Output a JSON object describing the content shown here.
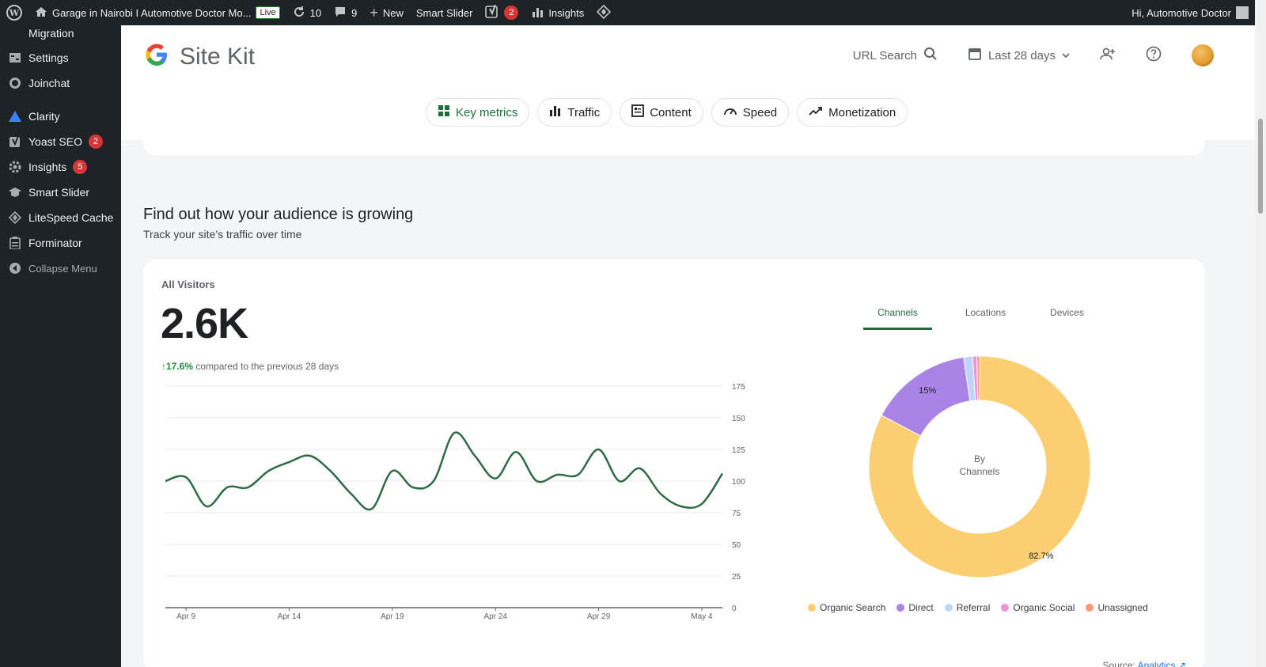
{
  "adminbar": {
    "site_title": "Garage in Nairobi I Automotive Doctor Mo...",
    "live_label": "Live",
    "updates_count": "10",
    "comments_count": "9",
    "new_label": "New",
    "smart_slider_label": "Smart Slider",
    "yoast_count": "2",
    "insights_label": "Insights",
    "greeting": "Hi, Automotive Doctor"
  },
  "sidebar": {
    "items": [
      {
        "label": "Migration"
      },
      {
        "label": "Settings"
      },
      {
        "label": "Joinchat"
      },
      {
        "label": "Clarity"
      },
      {
        "label": "Yoast SEO",
        "badge": "2"
      },
      {
        "label": "Insights",
        "badge": "5"
      },
      {
        "label": "Smart Slider"
      },
      {
        "label": "LiteSpeed Cache"
      },
      {
        "label": "Forminator"
      },
      {
        "label": "Collapse Menu"
      }
    ]
  },
  "header": {
    "brand": "Site Kit",
    "url_search": "URL Search",
    "date_range": "Last 28 days"
  },
  "nav_tabs": [
    {
      "label": "Key metrics"
    },
    {
      "label": "Traffic"
    },
    {
      "label": "Content"
    },
    {
      "label": "Speed"
    },
    {
      "label": "Monetization"
    }
  ],
  "section": {
    "title": "Find out how your audience is growing",
    "subtitle": "Track your site’s traffic over time"
  },
  "visitors": {
    "label": "All Visitors",
    "value": "2.6K",
    "change": "17.6%",
    "change_text": "compared to the previous 28 days"
  },
  "breakdown_tabs": [
    "Channels",
    "Locations",
    "Devices"
  ],
  "donut": {
    "center_line1": "By",
    "center_line2": "Channels"
  },
  "source": {
    "label": "Source:",
    "link": "Analytics"
  },
  "colors": {
    "line": "#2f6b45",
    "organic_search": "#fcce72",
    "direct": "#a983e6",
    "referral": "#bed4ff",
    "organic_social": "#ee92da",
    "unassigned": "#ff9b7a"
  },
  "chart_data": [
    {
      "type": "line",
      "x": [
        "Apr 8",
        "Apr 9",
        "Apr 10",
        "Apr 11",
        "Apr 12",
        "Apr 13",
        "Apr 14",
        "Apr 15",
        "Apr 16",
        "Apr 17",
        "Apr 18",
        "Apr 19",
        "Apr 20",
        "Apr 21",
        "Apr 22",
        "Apr 23",
        "Apr 24",
        "Apr 25",
        "Apr 26",
        "Apr 27",
        "Apr 28",
        "Apr 29",
        "Apr 30",
        "May 1",
        "May 2",
        "May 3",
        "May 4",
        "May 5"
      ],
      "x_tick_labels": [
        "Apr 9",
        "Apr 14",
        "Apr 19",
        "Apr 24",
        "Apr 29",
        "May 4"
      ],
      "series": [
        {
          "values": [
            100,
            103,
            80,
            95,
            95,
            108,
            115,
            120,
            108,
            90,
            78,
            108,
            95,
            100,
            138,
            120,
            102,
            123,
            100,
            105,
            105,
            125,
            100,
            110,
            90,
            80,
            82,
            106
          ]
        }
      ],
      "ylim": [
        0,
        175
      ],
      "yticks": [
        0,
        25,
        50,
        75,
        100,
        125,
        150,
        175
      ],
      "grid": true
    },
    {
      "type": "pie",
      "categories": [
        "Organic Search",
        "Direct",
        "Referral",
        "Organic Social",
        "Unassigned"
      ],
      "values": [
        82.7,
        15,
        1.3,
        0.6,
        0.4
      ],
      "labels": [
        "82.7%",
        "15%",
        "",
        "",
        ""
      ],
      "legend": "bottom"
    }
  ]
}
